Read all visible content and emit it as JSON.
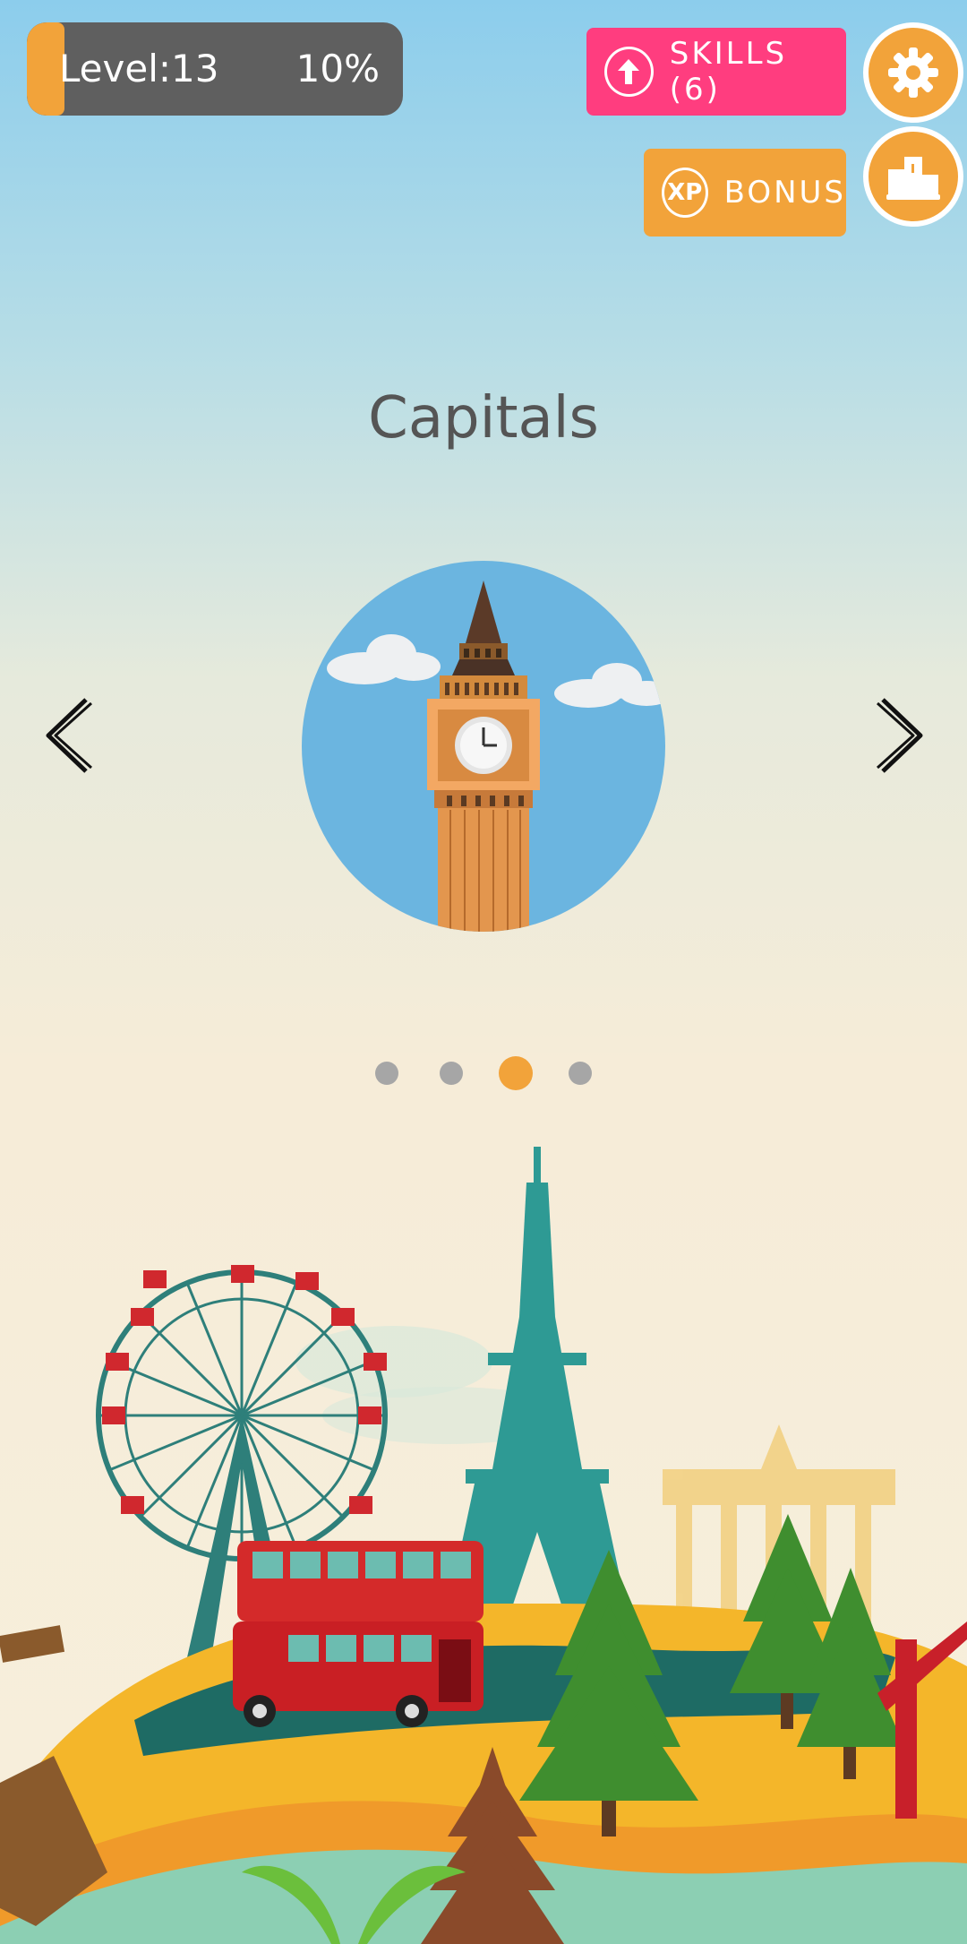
{
  "level": {
    "label": "Level:13",
    "percent_text": "10%",
    "progress": 0.1
  },
  "buttons": {
    "skills_label": "SKILLS (6)",
    "bonus_label": "BONUS",
    "bonus_icon_text": "XP"
  },
  "category": {
    "title": "Capitals"
  },
  "pager": {
    "count": 4,
    "active_index": 2
  },
  "colors": {
    "accent_orange": "#f2a33a",
    "skills_pink": "#ff3d7f",
    "level_bar_bg": "#5f5f5f"
  },
  "icons": {
    "skills": "arrow-up-circle-icon",
    "settings": "gear-icon",
    "leaderboard": "podium-icon",
    "prev": "chevron-left-icon",
    "next": "chevron-right-icon"
  }
}
